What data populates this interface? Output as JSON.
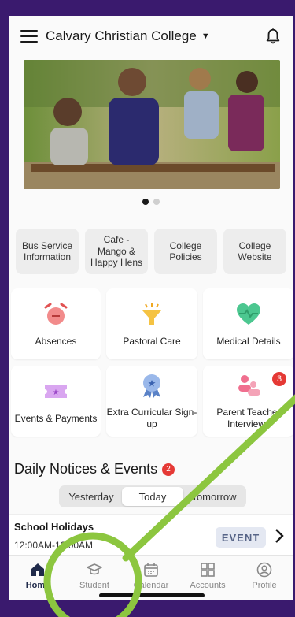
{
  "header": {
    "school_name": "Calvary Christian College"
  },
  "carousel": {
    "pages": 2,
    "active": 0
  },
  "quick_links": [
    "Bus Service Information",
    "Cafe - Mango & Happy Hens",
    "College Policies",
    "College Website"
  ],
  "tiles": [
    {
      "label": "Absences",
      "icon": "alarm-clock-icon"
    },
    {
      "label": "Pastoral Care",
      "icon": "funnel-icon"
    },
    {
      "label": "Medical Details",
      "icon": "heart-icon"
    },
    {
      "label": "Events & Payments",
      "icon": "ticket-icon"
    },
    {
      "label": "Extra Curricular Sign-up",
      "icon": "medal-icon"
    },
    {
      "label": "Parent Teacher Interviews",
      "icon": "people-icon",
      "badge": "3"
    }
  ],
  "notices": {
    "title": "Daily Notices & Events",
    "count": "2",
    "segments": [
      "Yesterday",
      "Today",
      "Tomorrow"
    ],
    "active_segment": "Today",
    "event": {
      "title": "School Holidays",
      "time": "12:00AM-12:00AM",
      "tag": "EVENT"
    }
  },
  "tabbar": [
    {
      "label": "Home",
      "icon": "home-icon",
      "active": true
    },
    {
      "label": "Student",
      "icon": "graduation-cap-icon"
    },
    {
      "label": "Calendar",
      "icon": "calendar-icon"
    },
    {
      "label": "Accounts",
      "icon": "grid-icon"
    },
    {
      "label": "Profile",
      "icon": "profile-icon"
    }
  ],
  "colors": {
    "frame": "#3a1a6e",
    "annotation": "#8cc63f",
    "badge": "#e53935",
    "event_tag_bg": "#e4e8f2"
  }
}
